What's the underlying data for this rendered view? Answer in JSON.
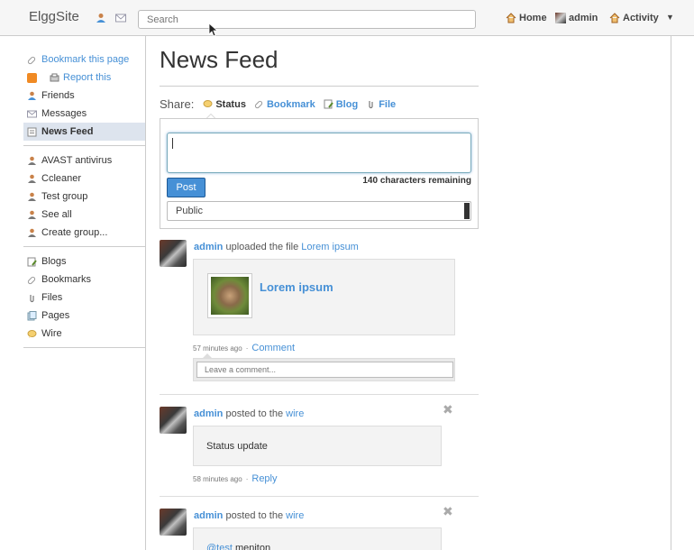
{
  "header": {
    "site_name": "ElggSite",
    "search_placeholder": "Search",
    "nav": {
      "home": "Home",
      "admin": "admin",
      "activity": "Activity"
    }
  },
  "sidebar": {
    "bookmark_page": "Bookmark this page",
    "report": "Report this",
    "group1": [
      "Friends",
      "Messages",
      "News Feed"
    ],
    "group2": [
      "AVAST antivirus",
      "Ccleaner",
      "Test group",
      "See all",
      "Create group..."
    ],
    "group3": [
      "Blogs",
      "Bookmarks",
      "Files",
      "Pages",
      "Wire"
    ]
  },
  "main": {
    "title": "News Feed",
    "share_label": "Share:",
    "tabs": [
      "Status",
      "Bookmark",
      "Blog",
      "File"
    ],
    "post_button": "Post",
    "remaining": "140 characters remaining",
    "access_value": "Public"
  },
  "feed": [
    {
      "user": "admin",
      "action": "uploaded the file",
      "object": "Lorem ipsum",
      "file_title": "Lorem ipsum",
      "time": "57 minutes ago",
      "action_link": "Comment",
      "comment_placeholder": "Leave a comment..."
    },
    {
      "user": "admin",
      "action": "posted to the",
      "object": "wire",
      "body": "Status update",
      "time": "58 minutes ago",
      "action_link": "Reply"
    },
    {
      "user": "admin",
      "action": "posted to the",
      "object": "wire",
      "body_mention": "@test",
      "body_rest": " meniton"
    }
  ],
  "colors": {
    "link": "#4690d6",
    "active_bg": "#dde4ee",
    "post_button": "#4690d6"
  },
  "icons": {
    "friends": "friends-icon",
    "messages": "envelope-icon",
    "rss": "rss-icon",
    "delete": "close-icon"
  }
}
